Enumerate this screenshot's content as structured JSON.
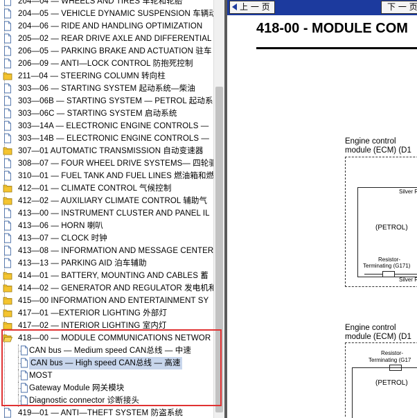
{
  "tree": {
    "items": [
      {
        "label": "204—04 — WHEELS AND TIRES 车轮和轮胎",
        "icon": "document-icon"
      },
      {
        "label": "204—05 — VEHICLE DYNAMIC SUSPENSION 车辆动",
        "icon": "document-icon"
      },
      {
        "label": "204—06 — RIDE AND HANDLING OPTIMIZATION",
        "icon": "document-icon"
      },
      {
        "label": "205—02 — REAR DRIVE AXLE AND DIFFERENTIAL",
        "icon": "document-icon"
      },
      {
        "label": "206—05 — PARKING BRAKE AND ACTUATION 驻车",
        "icon": "document-icon"
      },
      {
        "label": "206—09 — ANTI—LOCK CONTROL 防抱死控制",
        "icon": "document-icon"
      },
      {
        "label": "211—04 — STEERING COLUMN 转向柱",
        "icon": "folder-icon"
      },
      {
        "label": "303—06 — STARTING SYSTEM 起动系统—柴油",
        "icon": "document-icon"
      },
      {
        "label": "303—06B — STARTING SYSTEM — PETROL 起动系",
        "icon": "document-icon"
      },
      {
        "label": "303—06C — STARTING SYSTEM 启动系统",
        "icon": "document-icon"
      },
      {
        "label": "303—14A — ELECTRONIC ENGINE CONTROLS —",
        "icon": "document-icon"
      },
      {
        "label": "303—14B — ELECTRONIC ENGINE CONTROLS —",
        "icon": "document-icon"
      },
      {
        "label": "307—01 AUTOMATIC TRANSMISSION 自动变速器",
        "icon": "folder-icon"
      },
      {
        "label": "308—07 — FOUR WHEEL DRIVE SYSTEMS— 四轮驱",
        "icon": "document-icon"
      },
      {
        "label": "310—01 — FUEL TANK AND FUEL LINES 燃油箱和燃",
        "icon": "document-icon"
      },
      {
        "label": "412—01 — CLIMATE CONTROL 气候控制",
        "icon": "folder-icon"
      },
      {
        "label": "412—02 — AUXILIARY CLIMATE CONTROL 辅助气",
        "icon": "folder-icon"
      },
      {
        "label": "413—00 — INSTRUMENT CLUSTER AND PANEL IL",
        "icon": "document-icon"
      },
      {
        "label": "413—06 — HORN 喇叭",
        "icon": "document-icon"
      },
      {
        "label": "413—07 — CLOCK 时钟",
        "icon": "document-icon"
      },
      {
        "label": "413—08 — INFORMATION AND MESSAGE CENTER",
        "icon": "document-icon"
      },
      {
        "label": "413—13 — PARKING AID 泊车辅助",
        "icon": "document-icon"
      },
      {
        "label": "414—01 — BATTERY, MOUNTING AND CABLES 蓄",
        "icon": "folder-icon"
      },
      {
        "label": "414—02 — GENERATOR AND REGULATOR 发电机和",
        "icon": "folder-icon"
      },
      {
        "label": "415—00 INFORMATION AND ENTERTAINMENT SY",
        "icon": "folder-icon"
      },
      {
        "label": "417—01 —EXTERIOR LIGHTING 外部灯",
        "icon": "folder-icon"
      },
      {
        "label": "417—02 — INTERIOR LIGHTING 室内灯",
        "icon": "folder-icon"
      },
      {
        "label": "418—00 — MODULE COMMUNICATIONS NETWOR",
        "icon": "folder-open-icon"
      },
      {
        "label": "CAN bus — Medium speed CAN总线 — 中速",
        "icon": "document-icon",
        "child": true
      },
      {
        "label": "CAN bus — High speed CAN总线 — 高速",
        "icon": "document-icon",
        "child": true,
        "selected": true
      },
      {
        "label": "MOST",
        "icon": "document-icon",
        "child": true
      },
      {
        "label": "Gateway Module 网关模块",
        "icon": "document-icon",
        "child": true
      },
      {
        "label": "Diagnostic connector 诊断接头",
        "icon": "document-icon",
        "child": true
      },
      {
        "label": "419—01 — ANTI—THEFT SYSTEM 防盗系统",
        "icon": "document-icon"
      }
    ]
  },
  "doc": {
    "prev_label": "上 一 页",
    "next_label": "下 一 页",
    "title": "418-00 - MODULE COM",
    "diagram1": {
      "ecm_line1": "Engine control",
      "ecm_line2": "module (ECM) (D1",
      "silver_top": "Silver R",
      "petrol": "(PETROL)",
      "resistor_line1": "Resistor-",
      "resistor_line2": "Terminating (G171)",
      "silver_bottom": "Silver R"
    },
    "diagram2": {
      "ecm_line1": "Engine control",
      "ecm_line2": "module (ECM) (D1",
      "resistor_line1": "Resistor-",
      "resistor_line2": "Terminating (G17",
      "petrol": "(PETROL)"
    }
  },
  "colors": {
    "topbar": "#1c3a9e",
    "highlight": "#e03232",
    "selection": "#c8d6ec",
    "folder": "#f4c430"
  }
}
